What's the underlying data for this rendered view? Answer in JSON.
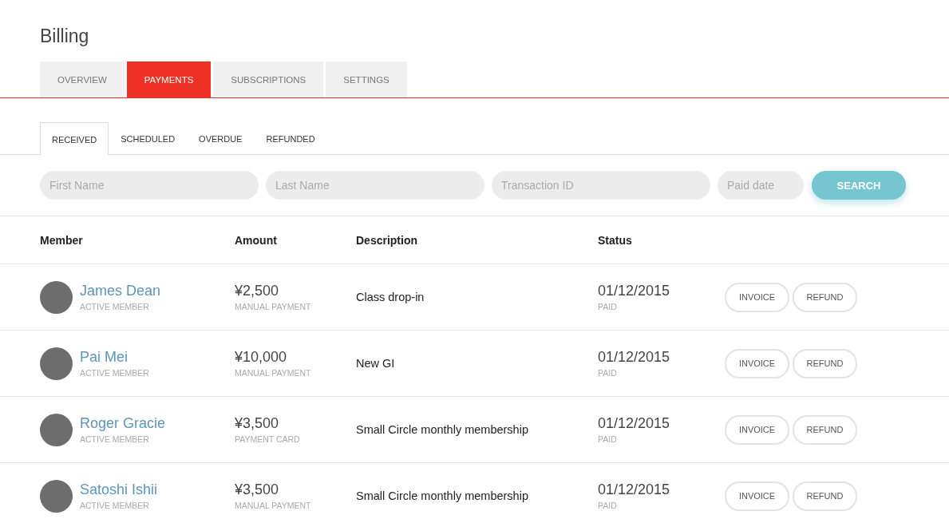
{
  "page": {
    "title": "Billing"
  },
  "tabs": [
    {
      "label": "OVERVIEW",
      "selected": false
    },
    {
      "label": "PAYMENTS",
      "selected": true
    },
    {
      "label": "SUBSCRIPTIONS",
      "selected": false
    },
    {
      "label": "SETTINGS",
      "selected": false
    }
  ],
  "subtabs": [
    {
      "label": "RECEIVED",
      "selected": true
    },
    {
      "label": "SCHEDULED",
      "selected": false
    },
    {
      "label": "OVERDUE",
      "selected": false
    },
    {
      "label": "REFUNDED",
      "selected": false
    }
  ],
  "filters": [
    {
      "placeholder": "First Name"
    },
    {
      "placeholder": "Last Name"
    },
    {
      "placeholder": "Transaction ID"
    },
    {
      "placeholder": "Paid date"
    }
  ],
  "search_button": "SEARCH",
  "table": {
    "columns": [
      "Member",
      "Amount",
      "Description",
      "Status"
    ],
    "rows": [
      {
        "name": "James Dean",
        "member_status": "ACTIVE MEMBER",
        "amount": "¥2,500",
        "method": "MANUAL PAYMENT",
        "description": "Class drop-in",
        "date": "01/12/2015",
        "status": "PAID",
        "actions": [
          "INVOICE",
          "REFUND"
        ]
      },
      {
        "name": "Pai Mei",
        "member_status": "ACTIVE MEMBER",
        "amount": "¥10,000",
        "method": "MANUAL PAYMENT",
        "description": "New GI",
        "date": "01/12/2015",
        "status": "PAID",
        "actions": [
          "INVOICE",
          "REFUND"
        ]
      },
      {
        "name": "Roger Gracie",
        "member_status": "ACTIVE MEMBER",
        "amount": "¥3,500",
        "method": "PAYMENT CARD",
        "description": "Small Circle monthly membership",
        "date": "01/12/2015",
        "status": "PAID",
        "actions": [
          "INVOICE",
          "REFUND"
        ]
      },
      {
        "name": "Satoshi Ishii",
        "member_status": "ACTIVE MEMBER",
        "amount": "¥3,500",
        "method": "MANUAL PAYMENT",
        "description": "Small Circle monthly membership",
        "date": "01/12/2015",
        "status": "PAID",
        "actions": [
          "INVOICE",
          "REFUND"
        ]
      }
    ]
  }
}
